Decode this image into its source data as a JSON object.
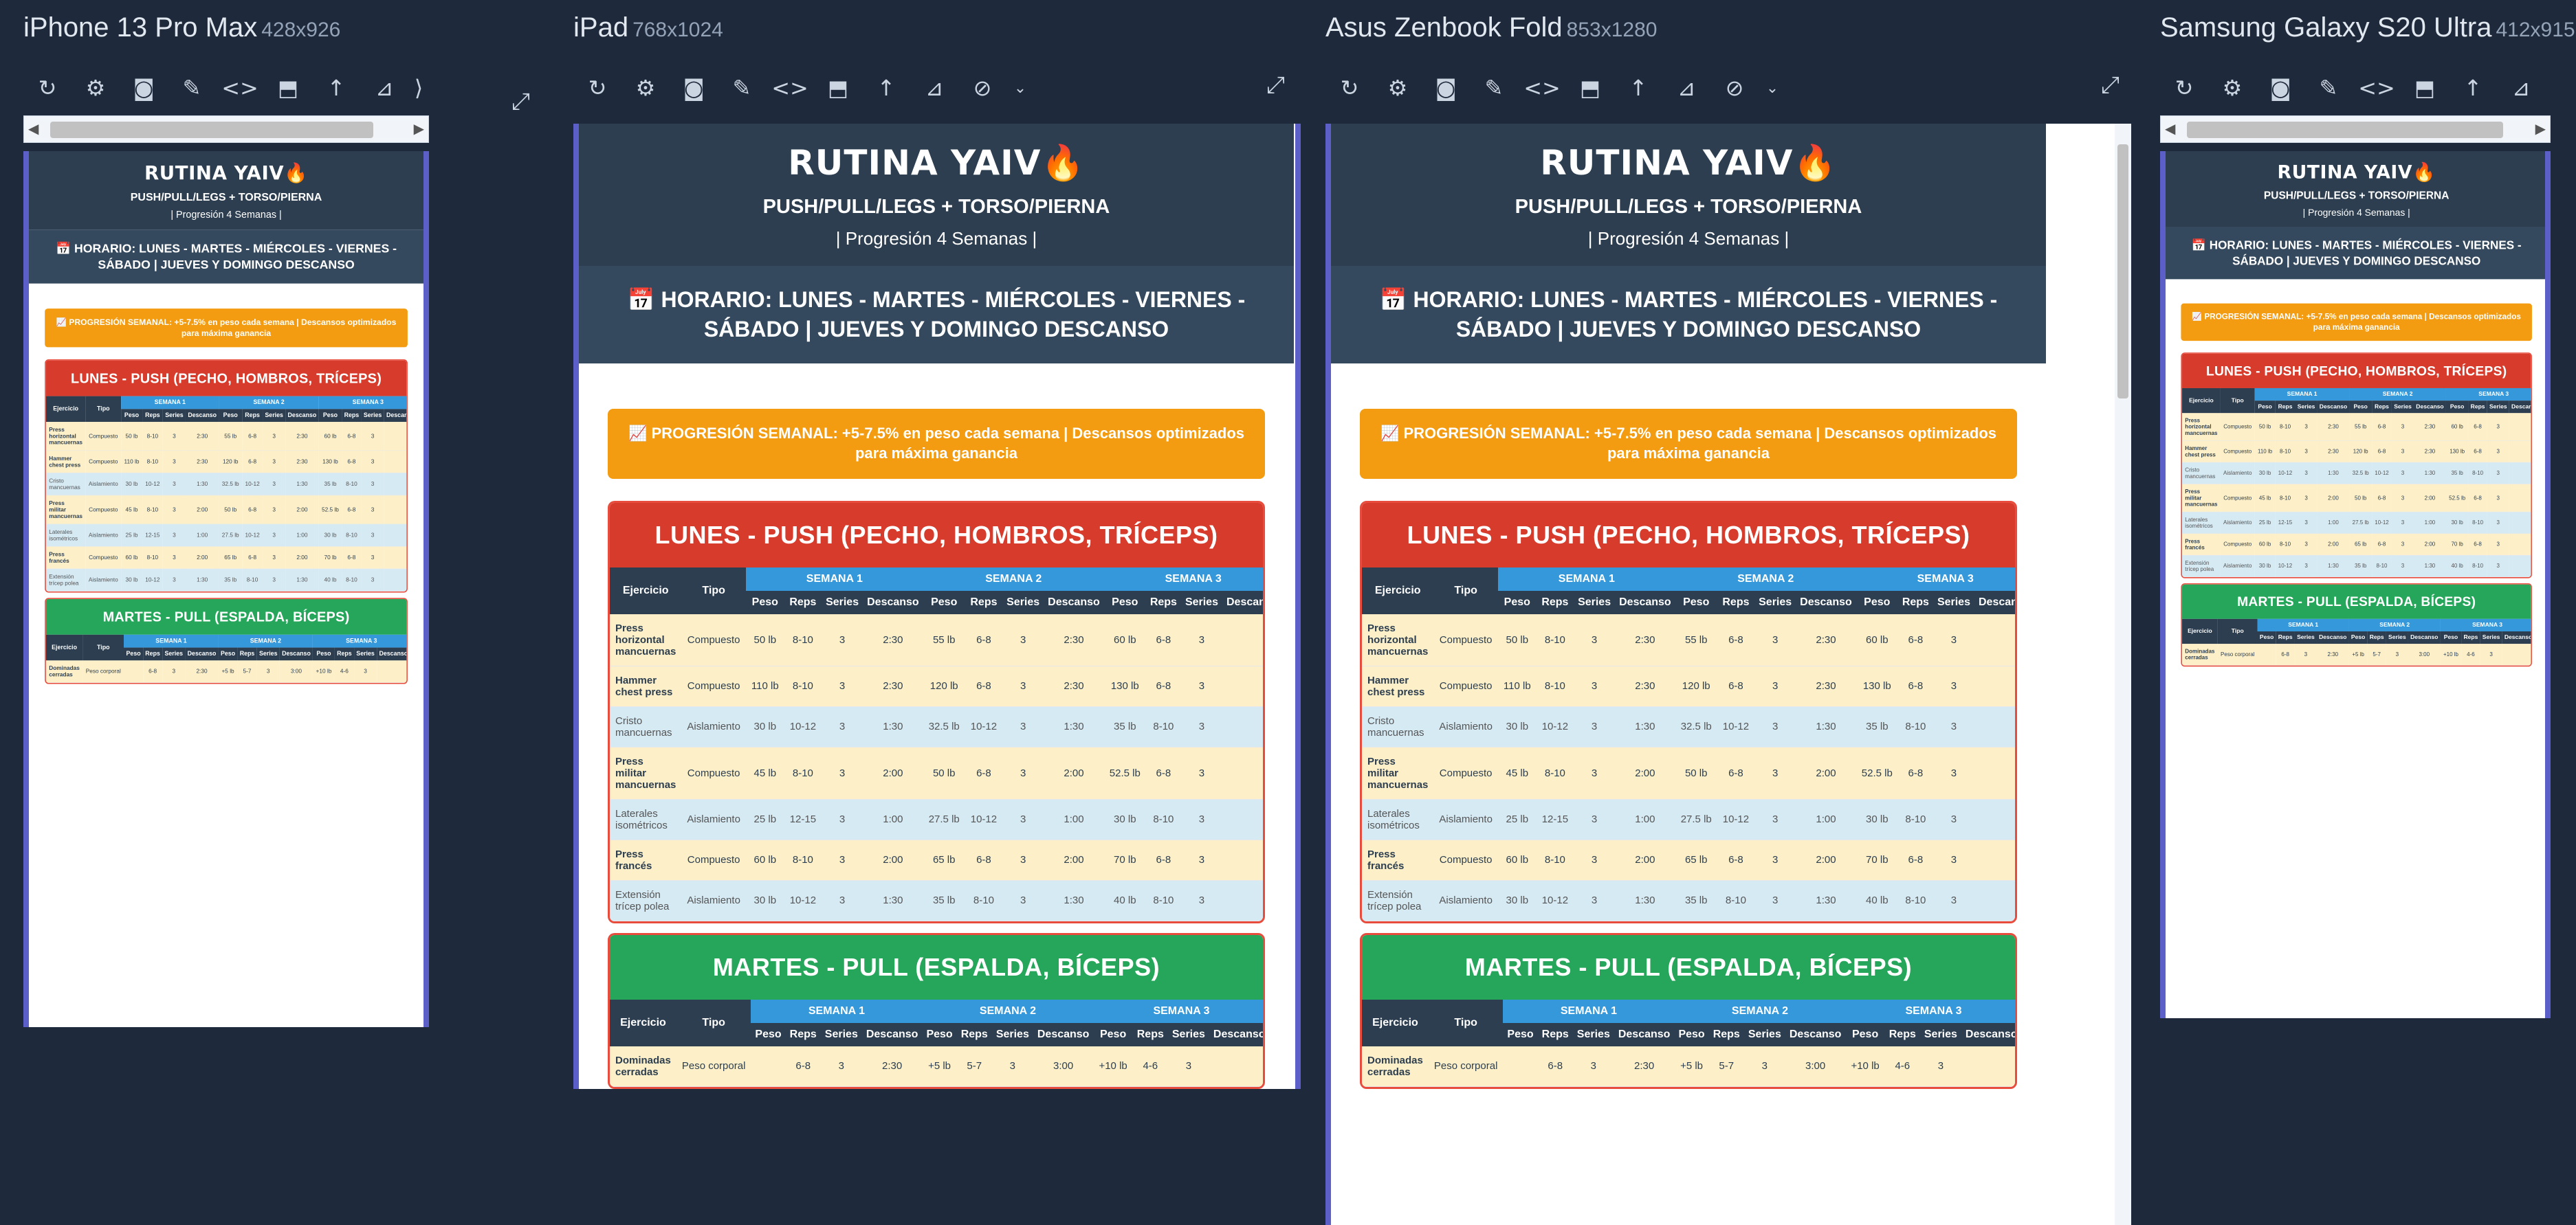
{
  "devices": [
    {
      "name": "iPhone 13 Pro Max",
      "dims": "428x926"
    },
    {
      "name": "iPad",
      "dims": "768x1024"
    },
    {
      "name": "Asus Zenbook Fold",
      "dims": "853x1280"
    },
    {
      "name": "Samsung Galaxy S20 Ultra",
      "dims": "412x915"
    }
  ],
  "toolbar_icons": [
    "refresh-icon",
    "screenshot-settings-icon",
    "camera-icon",
    "color-picker-icon",
    "code-icon",
    "rotate-device-icon",
    "arrow-up-icon",
    "ruler-icon",
    "hide-icon"
  ],
  "page": {
    "title": "RUTINA YAIV🔥",
    "subtitle": "PUSH/PULL/LEGS + TORSO/PIERNA",
    "progression_line": "| Progresión 4 Semanas |",
    "schedule": "📅 HORARIO: LUNES - MARTES - MIÉRCOLES - VIERNES - SÁBADO | JUEVES Y DOMINGO DESCANSO",
    "progression_banner": "📈 PROGRESIÓN SEMANAL: +5-7.5% en peso cada semana | Descansos optimizados para máxima ganancia",
    "headers": {
      "ejercicio": "Ejercicio",
      "tipo": "Tipo",
      "peso": "Peso",
      "reps": "Reps",
      "series": "Series",
      "descanso": "Descanso"
    },
    "weeks": [
      "SEMANA 1",
      "SEMANA 2",
      "SEMANA 3"
    ],
    "days": [
      {
        "title": "LUNES - PUSH (PECHO, HOMBROS, TRÍCEPS)",
        "color": "#d63b2c",
        "rows": [
          {
            "ex": "Press horizontal mancuernas",
            "tipo": "Compuesto",
            "w": [
              [
                "50 lb",
                "8-10",
                "3",
                "2:30"
              ],
              [
                "55 lb",
                "6-8",
                "3",
                "2:30"
              ],
              [
                "60 lb",
                "6-8",
                "3"
              ]
            ]
          },
          {
            "ex": "Hammer chest press",
            "tipo": "Compuesto",
            "w": [
              [
                "110 lb",
                "8-10",
                "3",
                "2:30"
              ],
              [
                "120 lb",
                "6-8",
                "3",
                "2:30"
              ],
              [
                "130 lb",
                "6-8",
                "3"
              ]
            ]
          },
          {
            "ex": "Cristo mancuernas",
            "tipo": "Aislamiento",
            "w": [
              [
                "30 lb",
                "10-12",
                "3",
                "1:30"
              ],
              [
                "32.5 lb",
                "10-12",
                "3",
                "1:30"
              ],
              [
                "35 lb",
                "8-10",
                "3"
              ]
            ]
          },
          {
            "ex": "Press militar mancuernas",
            "tipo": "Compuesto",
            "w": [
              [
                "45 lb",
                "8-10",
                "3",
                "2:00"
              ],
              [
                "50 lb",
                "6-8",
                "3",
                "2:00"
              ],
              [
                "52.5 lb",
                "6-8",
                "3"
              ]
            ]
          },
          {
            "ex": "Laterales isométricos",
            "tipo": "Aislamiento",
            "w": [
              [
                "25 lb",
                "12-15",
                "3",
                "1:00"
              ],
              [
                "27.5 lb",
                "10-12",
                "3",
                "1:00"
              ],
              [
                "30 lb",
                "8-10",
                "3"
              ]
            ]
          },
          {
            "ex": "Press francés",
            "tipo": "Compuesto",
            "w": [
              [
                "60 lb",
                "8-10",
                "3",
                "2:00"
              ],
              [
                "65 lb",
                "6-8",
                "3",
                "2:00"
              ],
              [
                "70 lb",
                "6-8",
                "3"
              ]
            ]
          },
          {
            "ex": "Extensión trícep polea",
            "tipo": "Aislamiento",
            "w": [
              [
                "30 lb",
                "10-12",
                "3",
                "1:30"
              ],
              [
                "35 lb",
                "8-10",
                "3",
                "1:30"
              ],
              [
                "40 lb",
                "8-10",
                "3"
              ]
            ]
          }
        ]
      },
      {
        "title": "MARTES - PULL (ESPALDA, BÍCEPS)",
        "color": "#26a65b",
        "rows": [
          {
            "ex": "Dominadas cerradas",
            "tipo": "Peso corporal",
            "w": [
              [
                "",
                "6-8",
                "3",
                "2:30"
              ],
              [
                "+5 lb",
                "5-7",
                "3",
                "3:00"
              ],
              [
                "+10 lb",
                "4-6",
                "3"
              ]
            ]
          }
        ]
      }
    ],
    "monday_title_wrapped": "LUNES - PUSH (PECHO, HOMBROS, TRÍCEPS)",
    "tuesday_title_short": "MARTES - PULL"
  }
}
